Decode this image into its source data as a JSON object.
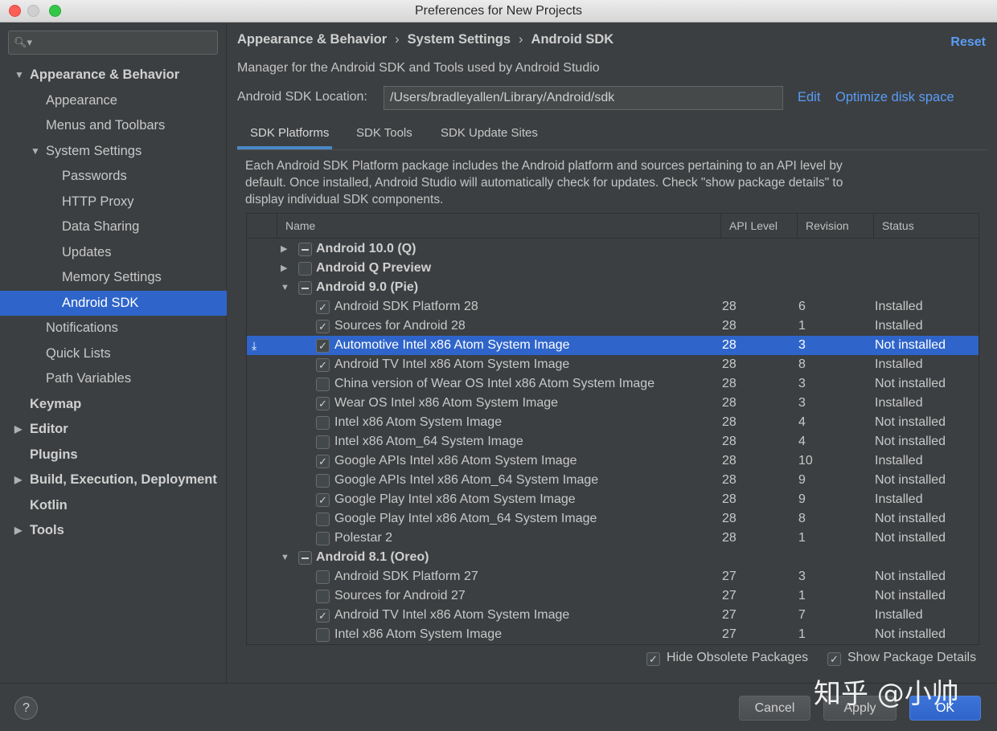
{
  "window": {
    "title": "Preferences for New Projects"
  },
  "sidebar": {
    "search_placeholder": "",
    "items": [
      {
        "label": "Appearance & Behavior",
        "level": 0,
        "bold": true,
        "arrow": "down"
      },
      {
        "label": "Appearance",
        "level": 1
      },
      {
        "label": "Menus and Toolbars",
        "level": 1
      },
      {
        "label": "System Settings",
        "level": 1,
        "arrow": "down"
      },
      {
        "label": "Passwords",
        "level": 2
      },
      {
        "label": "HTTP Proxy",
        "level": 2
      },
      {
        "label": "Data Sharing",
        "level": 2
      },
      {
        "label": "Updates",
        "level": 2
      },
      {
        "label": "Memory Settings",
        "level": 2
      },
      {
        "label": "Android SDK",
        "level": 2,
        "selected": true
      },
      {
        "label": "Notifications",
        "level": 1
      },
      {
        "label": "Quick Lists",
        "level": 1
      },
      {
        "label": "Path Variables",
        "level": 1
      },
      {
        "label": "Keymap",
        "level": 0,
        "bold": true
      },
      {
        "label": "Editor",
        "level": 0,
        "bold": true,
        "arrow": "right"
      },
      {
        "label": "Plugins",
        "level": 0,
        "bold": true
      },
      {
        "label": "Build, Execution, Deployment",
        "level": 0,
        "bold": true,
        "arrow": "right"
      },
      {
        "label": "Kotlin",
        "level": 0,
        "bold": true
      },
      {
        "label": "Tools",
        "level": 0,
        "bold": true,
        "arrow": "right"
      }
    ]
  },
  "header": {
    "breadcrumb": [
      "Appearance & Behavior",
      "System Settings",
      "Android SDK"
    ],
    "breadcrumb_sep": "›",
    "reset_label": "Reset"
  },
  "main": {
    "description": "Manager for the Android SDK and Tools used by Android Studio",
    "location_label": "Android SDK Location:",
    "location_value": "/Users/bradleyallen/Library/Android/sdk",
    "edit_label": "Edit",
    "optimize_label": "Optimize disk space",
    "tabs": [
      {
        "label": "SDK Platforms",
        "active": true
      },
      {
        "label": "SDK Tools"
      },
      {
        "label": "SDK Update Sites"
      }
    ],
    "info_text": "Each Android SDK Platform package includes the Android platform and sources pertaining to an API level by default. Once installed, Android Studio will automatically check for updates. Check \"show package details\" to display individual SDK components."
  },
  "table": {
    "columns": [
      "Name",
      "API Level",
      "Revision",
      "Status"
    ],
    "rows": [
      {
        "type": "group",
        "name": "Android 10.0 (Q)",
        "arrow": "right",
        "check": "partial"
      },
      {
        "type": "group",
        "name": "Android Q Preview",
        "arrow": "right",
        "check": "none"
      },
      {
        "type": "group",
        "name": "Android 9.0 (Pie)",
        "arrow": "down",
        "check": "partial"
      },
      {
        "type": "item",
        "name": "Android SDK Platform 28",
        "api": "28",
        "rev": "6",
        "status": "Installed",
        "checked": true
      },
      {
        "type": "item",
        "name": "Sources for Android 28",
        "api": "28",
        "rev": "1",
        "status": "Installed",
        "checked": true
      },
      {
        "type": "item",
        "name": "Automotive Intel x86 Atom System Image",
        "api": "28",
        "rev": "3",
        "status": "Not installed",
        "checked": true,
        "selected": true,
        "download": true
      },
      {
        "type": "item",
        "name": "Android TV Intel x86 Atom System Image",
        "api": "28",
        "rev": "8",
        "status": "Installed",
        "checked": true
      },
      {
        "type": "item",
        "name": "China version of Wear OS Intel x86 Atom System Image",
        "api": "28",
        "rev": "3",
        "status": "Not installed",
        "checked": false
      },
      {
        "type": "item",
        "name": "Wear OS Intel x86 Atom System Image",
        "api": "28",
        "rev": "3",
        "status": "Installed",
        "checked": true
      },
      {
        "type": "item",
        "name": "Intel x86 Atom System Image",
        "api": "28",
        "rev": "4",
        "status": "Not installed",
        "checked": false
      },
      {
        "type": "item",
        "name": "Intel x86 Atom_64 System Image",
        "api": "28",
        "rev": "4",
        "status": "Not installed",
        "checked": false
      },
      {
        "type": "item",
        "name": "Google APIs Intel x86 Atom System Image",
        "api": "28",
        "rev": "10",
        "status": "Installed",
        "checked": true
      },
      {
        "type": "item",
        "name": "Google APIs Intel x86 Atom_64 System Image",
        "api": "28",
        "rev": "9",
        "status": "Not installed",
        "checked": false
      },
      {
        "type": "item",
        "name": "Google Play Intel x86 Atom System Image",
        "api": "28",
        "rev": "9",
        "status": "Installed",
        "checked": true
      },
      {
        "type": "item",
        "name": "Google Play Intel x86 Atom_64 System Image",
        "api": "28",
        "rev": "8",
        "status": "Not installed",
        "checked": false
      },
      {
        "type": "item",
        "name": "Polestar 2",
        "api": "28",
        "rev": "1",
        "status": "Not installed",
        "checked": false
      },
      {
        "type": "group",
        "name": "Android 8.1 (Oreo)",
        "arrow": "down",
        "check": "partial"
      },
      {
        "type": "item",
        "name": "Android SDK Platform 27",
        "api": "27",
        "rev": "3",
        "status": "Not installed",
        "checked": false
      },
      {
        "type": "item",
        "name": "Sources for Android 27",
        "api": "27",
        "rev": "1",
        "status": "Not installed",
        "checked": false
      },
      {
        "type": "item",
        "name": "Android TV Intel x86 Atom System Image",
        "api": "27",
        "rev": "7",
        "status": "Installed",
        "checked": true
      },
      {
        "type": "item",
        "name": "Intel x86 Atom System Image",
        "api": "27",
        "rev": "1",
        "status": "Not installed",
        "checked": false
      }
    ]
  },
  "options": {
    "hide_obsolete_label": "Hide Obsolete Packages",
    "hide_obsolete_checked": true,
    "show_details_label": "Show Package Details",
    "show_details_checked": true
  },
  "footer": {
    "help_label": "?",
    "cancel_label": "Cancel",
    "apply_label": "Apply",
    "ok_label": "OK"
  },
  "watermark": "知乎 @小帅",
  "colors": {
    "selection": "#2f65ca",
    "link": "#589df6",
    "background": "#3c3f41"
  }
}
